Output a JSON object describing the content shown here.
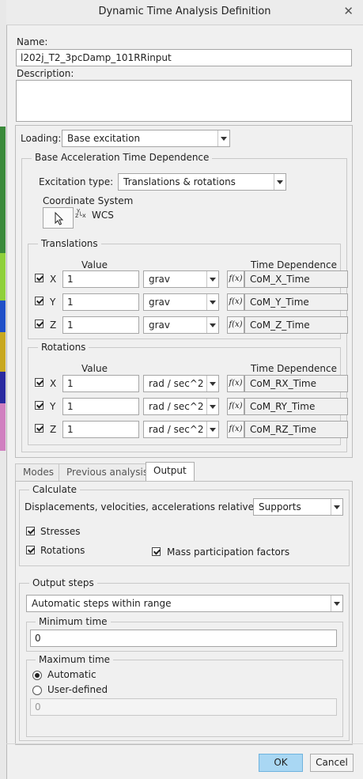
{
  "title": "Dynamic Time Analysis Definition",
  "name": {
    "label": "Name:",
    "value": "l202j_T2_3pcDamp_101RRinput"
  },
  "description": {
    "label": "Description:",
    "value": ""
  },
  "loading": {
    "label": "Loading:",
    "value": "Base excitation"
  },
  "base_group": {
    "title": "Base Acceleration Time Dependence"
  },
  "excitation": {
    "label": "Excitation type:",
    "value": "Translations & rotations"
  },
  "coord": {
    "label": "Coordinate System",
    "value": "WCS",
    "axes": "z└x",
    "y": "y"
  },
  "fx_label": "f(x)",
  "translations": {
    "title": "Translations",
    "value_header": "Value",
    "td_header": "Time Dependence",
    "rows": [
      {
        "axis": "X",
        "value": "1",
        "unit": "grav",
        "td": "CoM_X_Time"
      },
      {
        "axis": "Y",
        "value": "1",
        "unit": "grav",
        "td": "CoM_Y_Time"
      },
      {
        "axis": "Z",
        "value": "1",
        "unit": "grav",
        "td": "CoM_Z_Time"
      }
    ]
  },
  "rotations": {
    "title": "Rotations",
    "value_header": "Value",
    "td_header": "Time Dependence",
    "rows": [
      {
        "axis": "X",
        "value": "1",
        "unit": "rad / sec^2",
        "td": "CoM_RX_Time"
      },
      {
        "axis": "Y",
        "value": "1",
        "unit": "rad / sec^2",
        "td": "CoM_RY_Time"
      },
      {
        "axis": "Z",
        "value": "1",
        "unit": "rad / sec^2",
        "td": "CoM_RZ_Time"
      }
    ]
  },
  "tabs": [
    "Modes",
    "Previous analysis",
    "Output"
  ],
  "calculate": {
    "title": "Calculate",
    "relative_label": "Displacements, velocities, accelerations relative to:",
    "relative_value": "Supports",
    "stresses": "Stresses",
    "rotations": "Rotations",
    "mass": "Mass participation factors"
  },
  "output_steps": {
    "title": "Output steps",
    "value": "Automatic steps within range",
    "min_title": "Minimum time",
    "min_value": "0",
    "max_title": "Maximum time",
    "automatic": "Automatic",
    "user_defined": "User-defined",
    "max_value": "0"
  },
  "buttons": {
    "ok": "OK",
    "cancel": "Cancel"
  },
  "colors": {
    "accent": "#a9d7f3",
    "accent_border": "#6fb3de"
  }
}
